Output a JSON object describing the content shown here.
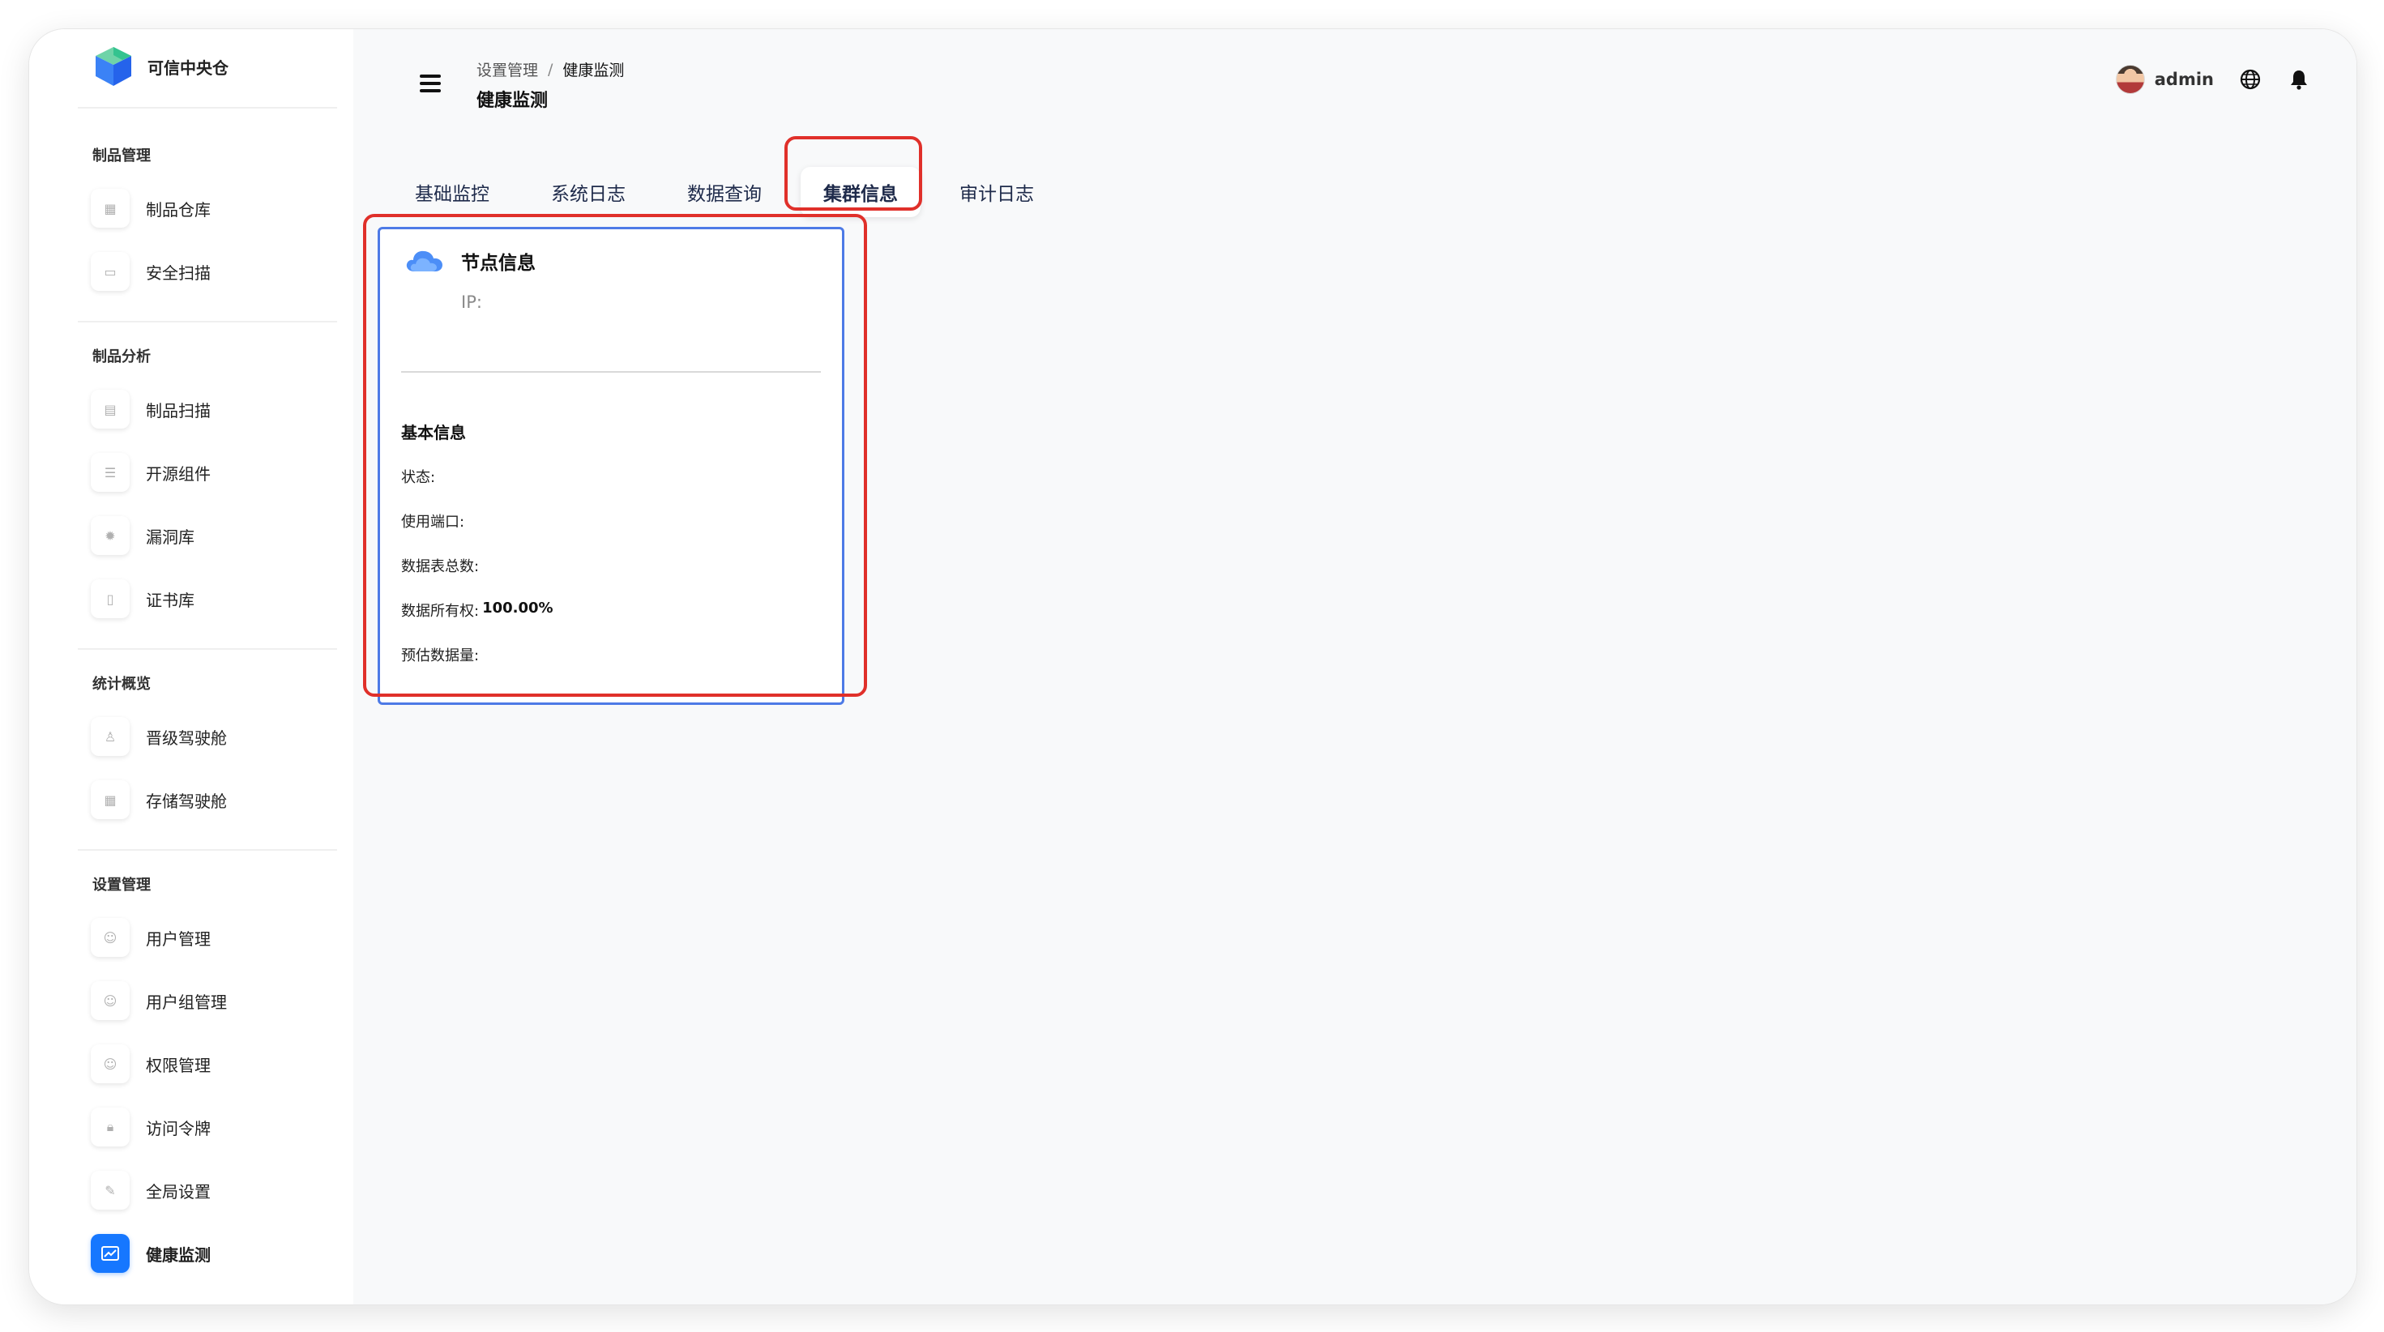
{
  "brand": {
    "name": "可信中央仓"
  },
  "sidebar": {
    "sections": [
      {
        "title": "制品管理",
        "items": [
          {
            "label": "制品仓库"
          },
          {
            "label": "安全扫描"
          }
        ]
      },
      {
        "title": "制品分析",
        "items": [
          {
            "label": "制品扫描"
          },
          {
            "label": "开源组件"
          },
          {
            "label": "漏洞库"
          },
          {
            "label": "证书库"
          }
        ]
      },
      {
        "title": "统计概览",
        "items": [
          {
            "label": "晋级驾驶舱"
          },
          {
            "label": "存储驾驶舱"
          }
        ]
      },
      {
        "title": "设置管理",
        "items": [
          {
            "label": "用户管理"
          },
          {
            "label": "用户组管理"
          },
          {
            "label": "权限管理"
          },
          {
            "label": "访问令牌"
          },
          {
            "label": "全局设置"
          },
          {
            "label": "健康监测"
          }
        ]
      }
    ],
    "active_item": "健康监测"
  },
  "header": {
    "breadcrumb": {
      "parent": "设置管理",
      "separator": "/",
      "current": "健康监测"
    },
    "title": "健康监测",
    "username": "admin"
  },
  "tabs": [
    {
      "label": "基础监控"
    },
    {
      "label": "系统日志"
    },
    {
      "label": "数据查询"
    },
    {
      "label": "集群信息"
    },
    {
      "label": "审计日志"
    }
  ],
  "active_tab": "集群信息",
  "node_card": {
    "title": "节点信息",
    "ip_label": "IP:",
    "section_title": "基本信息",
    "fields": [
      {
        "label": "状态:",
        "value": ""
      },
      {
        "label": "使用端口:",
        "value": ""
      },
      {
        "label": "数据表总数:",
        "value": ""
      },
      {
        "label": "数据所有权:",
        "value": "100.00%"
      },
      {
        "label": "预估数据量:",
        "value": ""
      }
    ]
  },
  "colors": {
    "accent": "#1677ff",
    "card_border": "#4d7ae6",
    "annotation": "#e0302a",
    "main_bg": "#f8f9fa"
  },
  "icons": {
    "brand": "cube-logo-icon",
    "menu": "hamburger-icon",
    "language": "globe-icon",
    "notifications": "bell-icon",
    "node": "cloud-icon"
  }
}
